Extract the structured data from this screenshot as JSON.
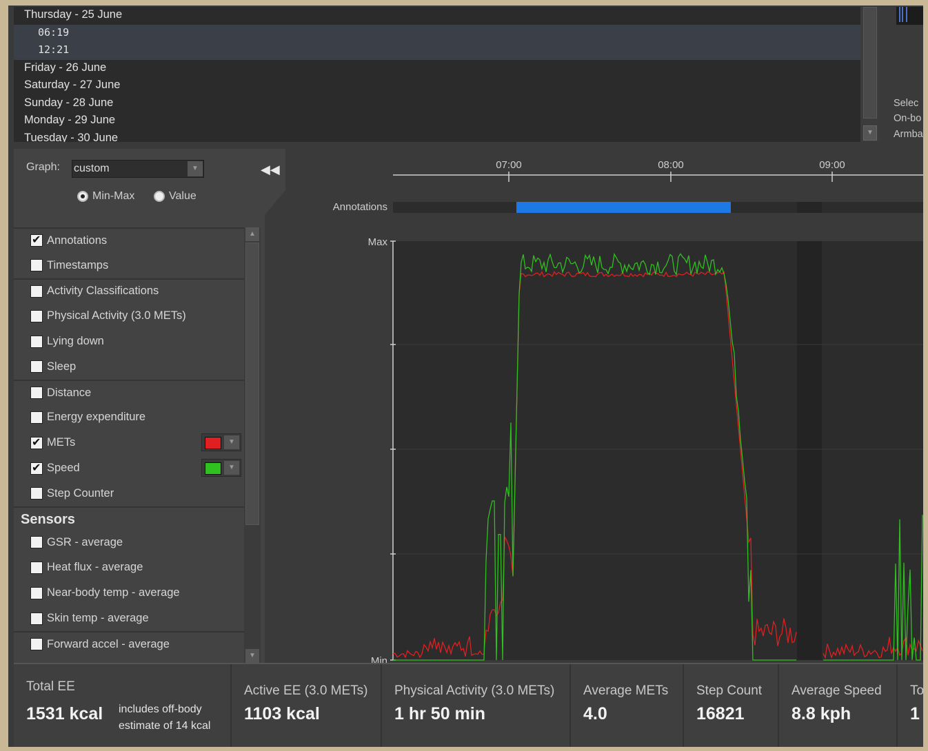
{
  "date_list": {
    "rows": [
      {
        "label": "Thursday - 25 June",
        "type": "day"
      },
      {
        "label": "06:19",
        "type": "time"
      },
      {
        "label": "12:21",
        "type": "time"
      },
      {
        "label": "Friday - 26 June",
        "type": "day"
      },
      {
        "label": "Saturday - 27 June",
        "type": "day"
      },
      {
        "label": "Sunday - 28 June",
        "type": "day"
      },
      {
        "label": "Monday - 29 June",
        "type": "day"
      },
      {
        "label": "Tuesday - 30 June",
        "type": "day"
      }
    ]
  },
  "right_info": {
    "lines": [
      "Selec",
      "On-bo",
      "Armba"
    ]
  },
  "graph_controls": {
    "graph_label": "Graph:",
    "graph_value": "custom",
    "mode_min_max": "Min-Max",
    "mode_value": "Value",
    "selected_mode": "min-max"
  },
  "checklist": {
    "groups": [
      {
        "items": [
          {
            "label": "Annotations",
            "checked": true
          },
          {
            "label": "Timestamps",
            "checked": false
          }
        ]
      },
      {
        "items": [
          {
            "label": "Activity Classifications",
            "checked": false
          },
          {
            "label": "Physical Activity (3.0 METs)",
            "checked": false
          },
          {
            "label": "Lying down",
            "checked": false
          },
          {
            "label": "Sleep",
            "checked": false
          }
        ]
      },
      {
        "items": [
          {
            "label": "Distance",
            "checked": false
          },
          {
            "label": "Energy expenditure",
            "checked": false
          },
          {
            "label": "METs",
            "checked": true,
            "color": "#e02020"
          },
          {
            "label": "Speed",
            "checked": true,
            "color": "#30c020"
          },
          {
            "label": "Step Counter",
            "checked": false
          }
        ]
      }
    ],
    "sensors_title": "Sensors",
    "sensor_groups": [
      {
        "items": [
          {
            "label": "GSR - average",
            "checked": false
          },
          {
            "label": "Heat flux - average",
            "checked": false
          },
          {
            "label": "Near-body temp - average",
            "checked": false
          },
          {
            "label": "Skin temp - average",
            "checked": false
          }
        ]
      },
      {
        "items": [
          {
            "label": "Forward accel - average",
            "checked": false
          }
        ]
      }
    ]
  },
  "chart_data": {
    "type": "line",
    "x_ticks": [
      "07:00",
      "08:00",
      "09:00"
    ],
    "annotations_label": "Annotations",
    "annotation_color": "#1e78e6",
    "y_top_label": "Max",
    "y_bottom_label": "Min",
    "series": [
      {
        "name": "METs",
        "color": "#e02020"
      },
      {
        "name": "Speed",
        "color": "#30c020"
      }
    ],
    "note": "series shape approximated from screenshot"
  },
  "stats": [
    {
      "label": "Total EE",
      "value": "1531 kcal",
      "note": [
        "includes off-body",
        "estimate of 14 kcal"
      ]
    },
    {
      "label": "Active EE (3.0 METs)",
      "value": "1103 kcal"
    },
    {
      "label": "Physical Activity (3.0 METs)",
      "value": "1 hr 50 min"
    },
    {
      "label": "Average METs",
      "value": "4.0"
    },
    {
      "label": "Step Count",
      "value": "16821"
    },
    {
      "label": "Average Speed",
      "value": "8.8 kph"
    },
    {
      "label": "To",
      "value": "1"
    }
  ]
}
